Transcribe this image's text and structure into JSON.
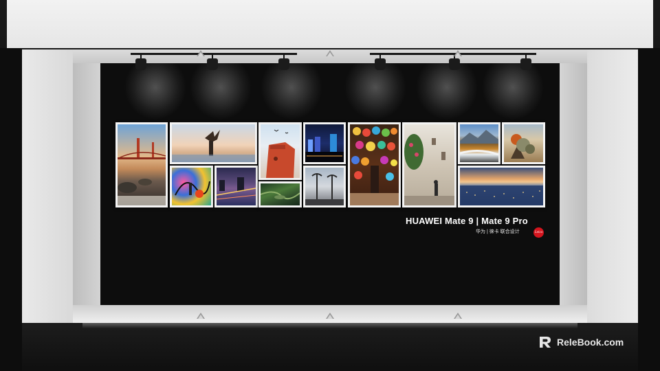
{
  "branding": {
    "title": "HUAWEI Mate 9 | Mate 9 Pro",
    "subtitle": "华为 | 徕卡  联合设计",
    "leica_logo_text": "Leica",
    "leica_color": "#d4151e"
  },
  "watermark": {
    "text": "RelеBook.com",
    "icon": "relebook-logo-icon"
  },
  "photos": [
    {
      "name": "golden-gate-bridge",
      "subject": "bridge over rocky shore at sunset"
    },
    {
      "name": "hair-flip-beach",
      "subject": "woman tossing hair at beach"
    },
    {
      "name": "graffiti-wall",
      "subject": "colorful graffiti mural"
    },
    {
      "name": "night-river",
      "subject": "city river at night"
    },
    {
      "name": "red-fortress",
      "subject": "red tower with birds"
    },
    {
      "name": "green-valley",
      "subject": "aerial green landscape"
    },
    {
      "name": "city-night-skyline",
      "subject": "city skyline at night"
    },
    {
      "name": "palm-street",
      "subject": "street with palm trees"
    },
    {
      "name": "lantern-market",
      "subject": "market with colorful lanterns"
    },
    {
      "name": "old-town-alley",
      "subject": "old town alley with person"
    },
    {
      "name": "mountain-river",
      "subject": "mountain river autumn"
    },
    {
      "name": "desert-cactus",
      "subject": "cactus in desert"
    },
    {
      "name": "city-sunset-aerial",
      "subject": "aerial city view at dusk"
    }
  ],
  "colors": {
    "wall": "#0d0d0d",
    "frame": "#e6e6e6",
    "photo_border": "#f4f4f4"
  }
}
